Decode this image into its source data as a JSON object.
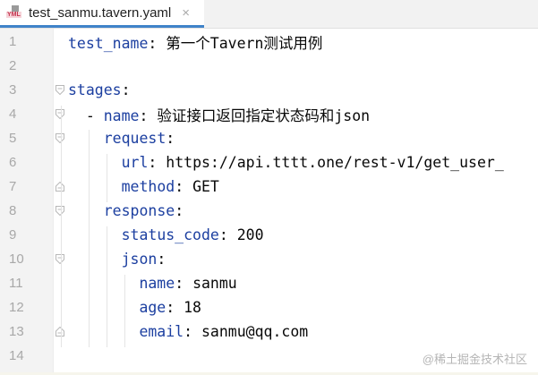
{
  "tab": {
    "icon": "yml-file-icon",
    "icon_text": "YML",
    "title": "test_sanmu.tavern.yaml",
    "close": "×"
  },
  "lines": [
    {
      "n": "1",
      "indent": 0,
      "key": "test_name",
      "sep": ": ",
      "val": "第一个Tavern测试用例",
      "fold": ""
    },
    {
      "n": "2",
      "indent": 0,
      "key": "",
      "sep": "",
      "val": "",
      "fold": ""
    },
    {
      "n": "3",
      "indent": 0,
      "key": "stages",
      "sep": ":",
      "val": "",
      "fold": "start"
    },
    {
      "n": "4",
      "indent": 1,
      "dash": "- ",
      "key": "name",
      "sep": ": ",
      "val": "验证接口返回指定状态码和json",
      "fold": "start"
    },
    {
      "n": "5",
      "indent": 2,
      "key": "request",
      "sep": ":",
      "val": "",
      "fold": "start"
    },
    {
      "n": "6",
      "indent": 3,
      "key": "url",
      "sep": ": ",
      "val": "https://api.tttt.one/rest-v1/get_user_",
      "fold": ""
    },
    {
      "n": "7",
      "indent": 3,
      "key": "method",
      "sep": ": ",
      "val": "GET",
      "fold": "end"
    },
    {
      "n": "8",
      "indent": 2,
      "key": "response",
      "sep": ":",
      "val": "",
      "fold": "start"
    },
    {
      "n": "9",
      "indent": 3,
      "key": "status_code",
      "sep": ": ",
      "val": "200",
      "fold": ""
    },
    {
      "n": "10",
      "indent": 3,
      "key": "json",
      "sep": ":",
      "val": "",
      "fold": "start"
    },
    {
      "n": "11",
      "indent": 4,
      "key": "name",
      "sep": ": ",
      "val": "sanmu",
      "fold": ""
    },
    {
      "n": "12",
      "indent": 4,
      "key": "age",
      "sep": ": ",
      "val": "18",
      "fold": ""
    },
    {
      "n": "13",
      "indent": 4,
      "key": "email",
      "sep": ": ",
      "val": "sanmu@qq.com",
      "fold": "end"
    },
    {
      "n": "14",
      "indent": 0,
      "key": "",
      "sep": "",
      "val": "",
      "fold": ""
    }
  ],
  "watermark": "@稀土掘金技术社区"
}
